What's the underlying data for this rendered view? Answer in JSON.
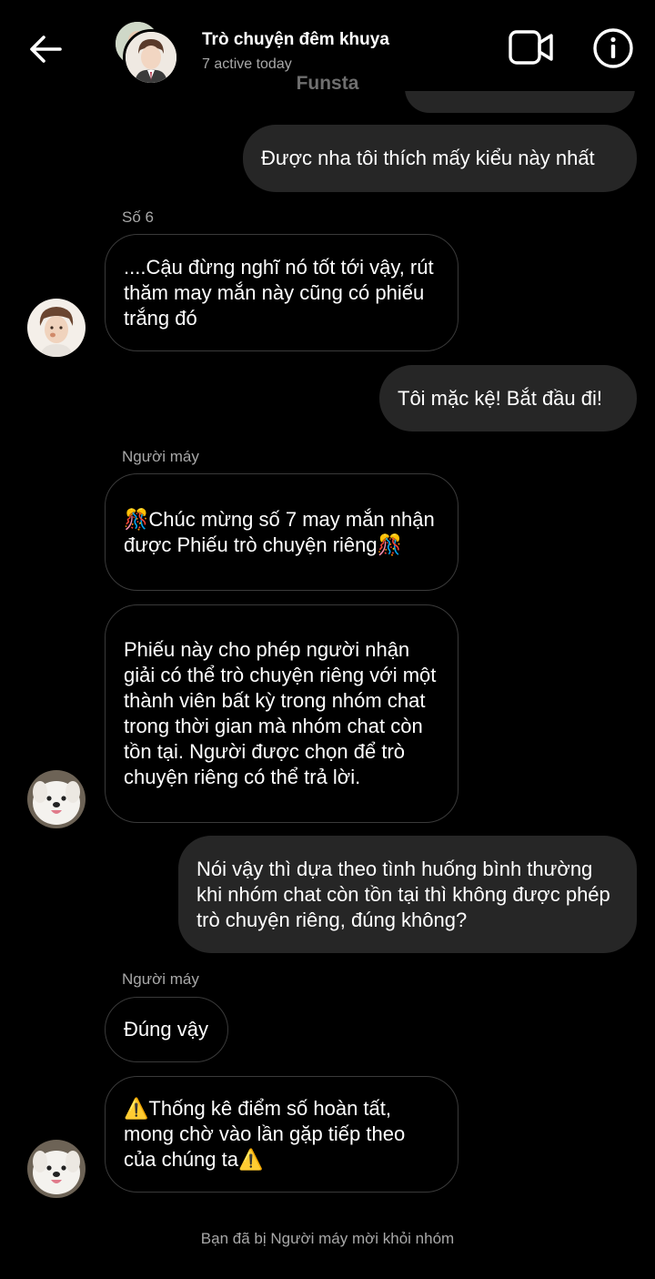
{
  "header": {
    "title": "Trò chuyện đêm khuya",
    "status": "7 active today",
    "back_icon": "arrow-left-icon",
    "video_icon": "video-camera-icon",
    "info_icon": "info-circle-icon"
  },
  "overlay_label": "Funsta",
  "messages": [
    {
      "sender": "me",
      "text": "Được nha tôi thích mấy kiểu này nhất"
    },
    {
      "sender_name": "Số 6",
      "text": "....Cậu đừng nghĩ nó tốt tới vậy, rút thăm may mắn này cũng có phiếu trắng đó"
    },
    {
      "sender": "me",
      "text": "Tôi mặc kệ! Bắt đầu đi!"
    },
    {
      "sender_name": "Người máy",
      "text": "🎊Chúc mừng số 7 may mắn nhận được Phiếu trò chuyện riêng🎊"
    },
    {
      "text": "Phiếu này cho phép người nhận giải có thể trò chuyện riêng với một thành viên bất kỳ trong nhóm chat trong thời gian mà nhóm chat còn tồn tại. Người được chọn để trò chuyện riêng có thể trả lời."
    },
    {
      "sender": "me",
      "text": "Nói vậy thì dựa theo tình huống bình thường khi nhóm chat còn tồn tại thì không được phép trò chuyện riêng, đúng không?"
    },
    {
      "sender_name": "Người máy",
      "text": "Đúng vậy"
    },
    {
      "text": "⚠️Thống kê điểm số hoàn tất, mong chờ vào lần gặp tiếp theo của chúng ta⚠️"
    }
  ],
  "system_note": "Bạn đã bị Người máy mời khỏi nhóm",
  "colors": {
    "background": "#000000",
    "my_bubble": "#262626",
    "secondary_text": "#a8a8a8"
  }
}
